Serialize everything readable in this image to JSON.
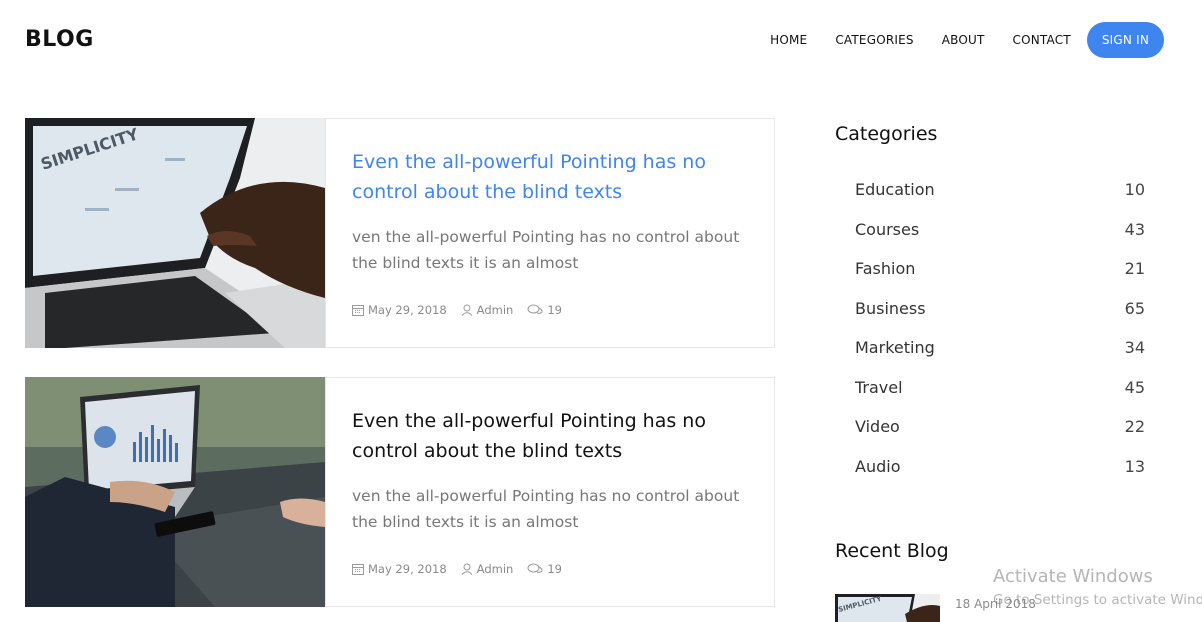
{
  "header": {
    "logo": "BLOG",
    "nav": [
      {
        "label": "HOME"
      },
      {
        "label": "CATEGORIES"
      },
      {
        "label": "ABOUT"
      },
      {
        "label": "CONTACT"
      }
    ],
    "signin_label": "SIGN IN"
  },
  "posts": [
    {
      "title": "Even the all-powerful Pointing has no control about the blind texts",
      "excerpt": "ven the all-powerful Pointing has no control about the blind texts it is an almost",
      "date": "May 29, 2018",
      "author": "Admin",
      "comments": "19",
      "title_color": "#3f85f0"
    },
    {
      "title": "Even the all-powerful Pointing has no control about the blind texts",
      "excerpt": "ven the all-powerful Pointing has no control about the blind texts it is an almost",
      "date": "May 29, 2018",
      "author": "Admin",
      "comments": "19",
      "title_color": "#111111"
    }
  ],
  "sidebar": {
    "categories_title": "Categories",
    "categories": [
      {
        "name": "Education",
        "count": "10"
      },
      {
        "name": "Courses",
        "count": "43"
      },
      {
        "name": "Fashion",
        "count": "21"
      },
      {
        "name": "Business",
        "count": "65"
      },
      {
        "name": "Marketing",
        "count": "34"
      },
      {
        "name": "Travel",
        "count": "45"
      },
      {
        "name": "Video",
        "count": "22"
      },
      {
        "name": "Audio",
        "count": "13"
      }
    ],
    "recent_title": "Recent Blog",
    "recent": [
      {
        "date": "18 April 2018"
      }
    ]
  },
  "watermark": {
    "line1": "Activate Windows",
    "line2": "Go to Settings to activate Windows."
  },
  "colors": {
    "accent": "#3f85f0",
    "border": "#e6e6e6",
    "muted": "#777777"
  },
  "icons": {
    "date": "calendar-icon",
    "author": "user-icon",
    "comments": "chat-icon"
  }
}
